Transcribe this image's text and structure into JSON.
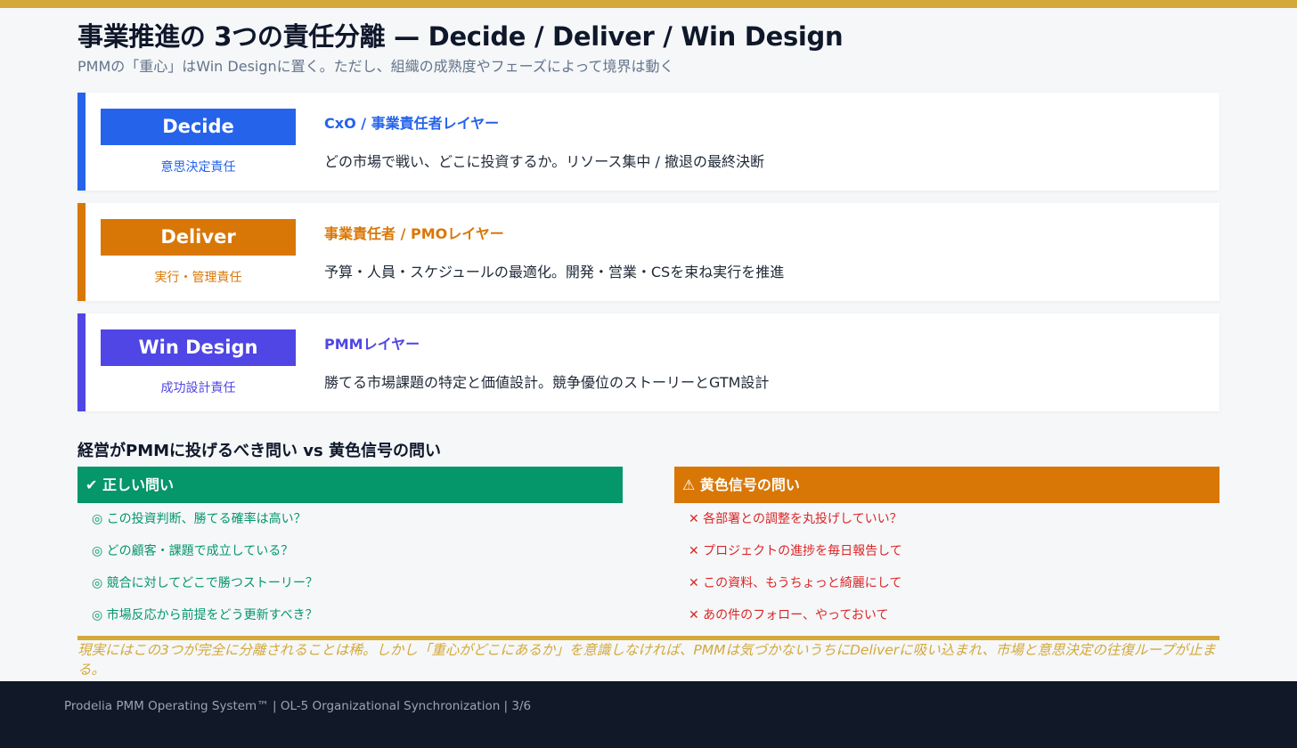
{
  "header": {
    "title": "事業推進の 3つの責任分離 — Decide / Deliver / Win Design",
    "subtitle": "PMMの「重心」はWin Designに置く。ただし、組織の成熟度やフェーズによって境界は動く"
  },
  "layers": [
    {
      "badge": "Decide",
      "role": "意思決定責任",
      "layer": "CxO / 事業責任者レイヤー",
      "description": "どの市場で戦い、どこに投資するか。リソース集中 / 撤退の最終決断"
    },
    {
      "badge": "Deliver",
      "role": "実行・管理責任",
      "layer": "事業責任者 / PMOレイヤー",
      "description": "予算・人員・スケジュールの最適化。開発・営業・CSを束ね実行を推進"
    },
    {
      "badge": "Win Design",
      "role": "成功設計責任",
      "layer": "PMMレイヤー",
      "description": "勝てる市場課題の特定と価値設計。競争優位のストーリーとGTM設計"
    }
  ],
  "questions": {
    "title": "経営がPMMに投げるべき問い vs 黄色信号の問い",
    "good": {
      "icon": "check-icon",
      "header": "正しい問い",
      "items": [
        "◎ この投資判断、勝てる確率は高い？",
        "◎ どの顧客・課題で成立している？",
        "◎ 競合に対してどこで勝つストーリー？",
        "◎ 市場反応から前提をどう更新すべき？"
      ]
    },
    "warn": {
      "icon": "warning-icon",
      "header": "黄色信号の問い",
      "items": [
        "✕ 各部署との調整を丸投げしていい？",
        "✕ プロジェクトの進捗を毎日報告して",
        "✕ この資料、もうちょっと綺麗にして",
        "✕ あの件のフォロー、やっておいて"
      ]
    }
  },
  "note": "現実にはこの3つが完全に分離されることは稀。しかし「重心がどこにあるか」を意識しなければ、PMMは気づかないうちにDeliverに吸い込まれ、市場と意思決定の往復ループが止まる。",
  "footer": {
    "text": "Prodelia PMM Operating System™  |  OL-5 Organizational Synchronization  |  3/6"
  },
  "colors": {
    "accent_gold": "#d4a93b",
    "decide_blue": "#2563eb",
    "deliver_orange": "#d97706",
    "windesign_indigo": "#4f46e5",
    "good_green": "#059669",
    "warn_red": "#dc2626",
    "footer_bg": "#111827"
  }
}
